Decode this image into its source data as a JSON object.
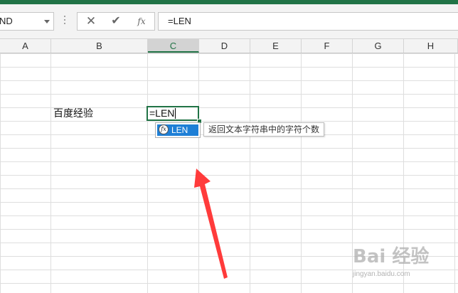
{
  "name_box": {
    "value": "ND"
  },
  "formula_bar": {
    "cancel_icon": "✕",
    "enter_icon": "✔",
    "fx_label": "fx",
    "formula": "=LEN"
  },
  "columns": [
    "A",
    "B",
    "C",
    "D",
    "E",
    "F",
    "G",
    "H"
  ],
  "selected_column": "C",
  "cells": {
    "b5": "百度经验",
    "c5": "=LEN"
  },
  "autocomplete": {
    "icon_label": "fx",
    "item": "LEN",
    "tooltip": "返回文本字符串中的字符个数"
  },
  "annotation": {
    "color": "#ff3b3b"
  },
  "watermark": {
    "logo": "Bai 经验",
    "url": "jingyan.baidu.com"
  },
  "colors": {
    "accent": "#217346",
    "selection": "#1e7fd6"
  }
}
